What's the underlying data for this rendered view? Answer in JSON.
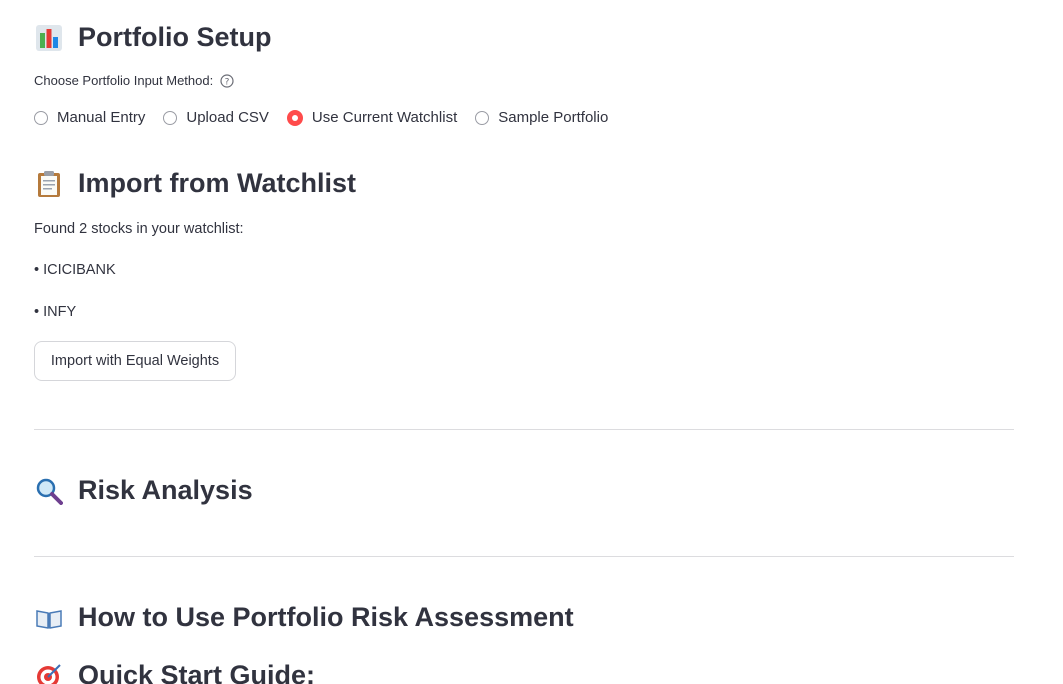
{
  "portfolio_setup": {
    "title": "Portfolio Setup",
    "icon": "bar-chart-icon",
    "input_label": "Choose Portfolio Input Method:",
    "help_icon": "question-circle-icon",
    "options": [
      {
        "label": "Manual Entry",
        "selected": false
      },
      {
        "label": "Upload CSV",
        "selected": false
      },
      {
        "label": "Use Current Watchlist",
        "selected": true
      },
      {
        "label": "Sample Portfolio",
        "selected": false
      }
    ]
  },
  "import_section": {
    "title": "Import from Watchlist",
    "icon": "clipboard-icon",
    "found_text": "Found 2 stocks in your watchlist:",
    "stocks": [
      "• ICICIBANK",
      "• INFY"
    ],
    "button_label": "Import with Equal Weights"
  },
  "risk_section": {
    "title": "Risk Analysis",
    "icon": "magnifier-icon"
  },
  "howto_section": {
    "title": "How to Use Portfolio Risk Assessment",
    "icon": "open-book-icon"
  },
  "quickstart_section": {
    "title": "Quick Start Guide:",
    "icon": "target-icon"
  },
  "colors": {
    "accent": "#ff4b4b",
    "text": "#31333f",
    "divider": "#dcdcdf"
  }
}
